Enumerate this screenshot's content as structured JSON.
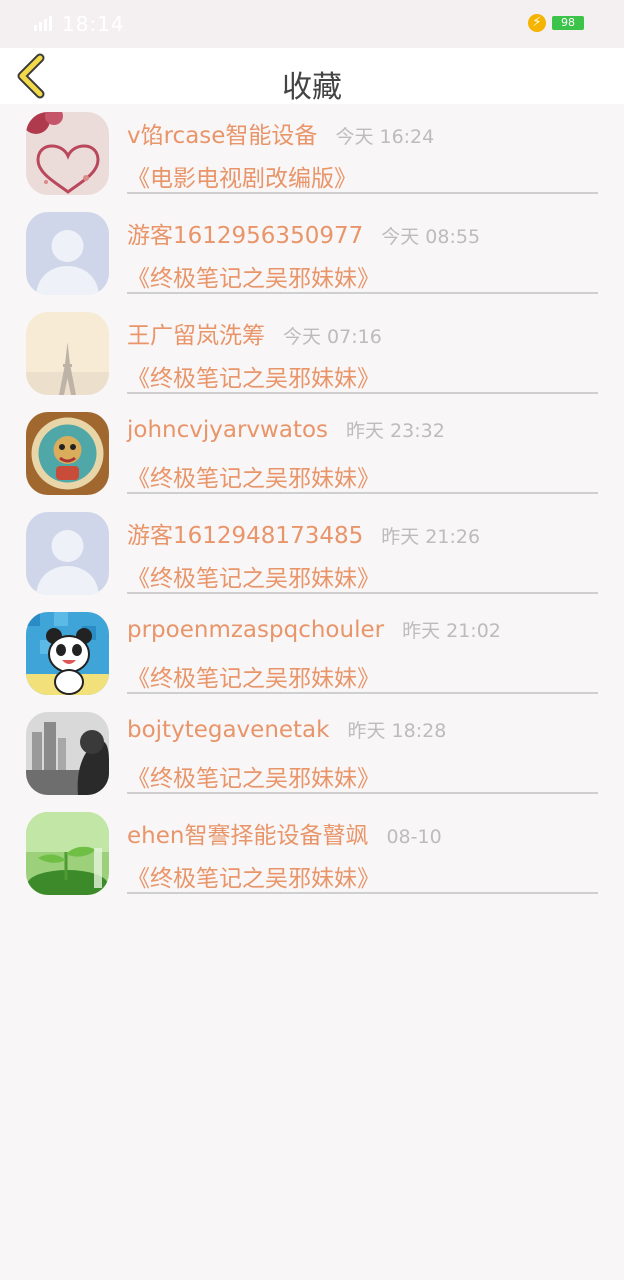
{
  "status_bar": {
    "time": "18:14",
    "battery": "98"
  },
  "header": {
    "title": "收藏"
  },
  "colors": {
    "accent": "#e9956a",
    "time_text": "#bcbcbc",
    "back_icon": "#f1d94a"
  },
  "favorites": [
    {
      "name": "v馅rcase智能设备",
      "time": "今天 16:24",
      "work": "《电影电视剧改编版》",
      "avatar": "lace-heart-avatar"
    },
    {
      "name": "游客1612956350977",
      "time": "今天 08:55",
      "work": "《终极笔记之吴邪妹妹》",
      "avatar": "default-user-avatar"
    },
    {
      "name": "王广留岚洗筹",
      "time": "今天 07:16",
      "work": "《终极笔记之吴邪妹妹》",
      "avatar": "eiffel-tower-avatar"
    },
    {
      "name": "johncvjyarvwatos",
      "time": "昨天 23:32",
      "work": "《终极笔记之吴邪妹妹》",
      "avatar": "cartoon-emblem-avatar"
    },
    {
      "name": "游客1612948173485",
      "time": "昨天 21:26",
      "work": "《终极笔记之吴邪妹妹》",
      "avatar": "default-user-avatar"
    },
    {
      "name": "prpoenmzaspqchouler",
      "time": "昨天 21:02",
      "work": "《终极笔记之吴邪妹妹》",
      "avatar": "panda-avatar"
    },
    {
      "name": "bojtytegavenetak",
      "time": "昨天 18:28",
      "work": "《终极笔记之吴邪妹妹》",
      "avatar": "city-photo-avatar"
    },
    {
      "name": "ehen智謇择能设备瞽飒",
      "time": "08-10",
      "work": "《终极笔记之吴邪妹妹》",
      "avatar": "green-sprout-avatar"
    }
  ]
}
